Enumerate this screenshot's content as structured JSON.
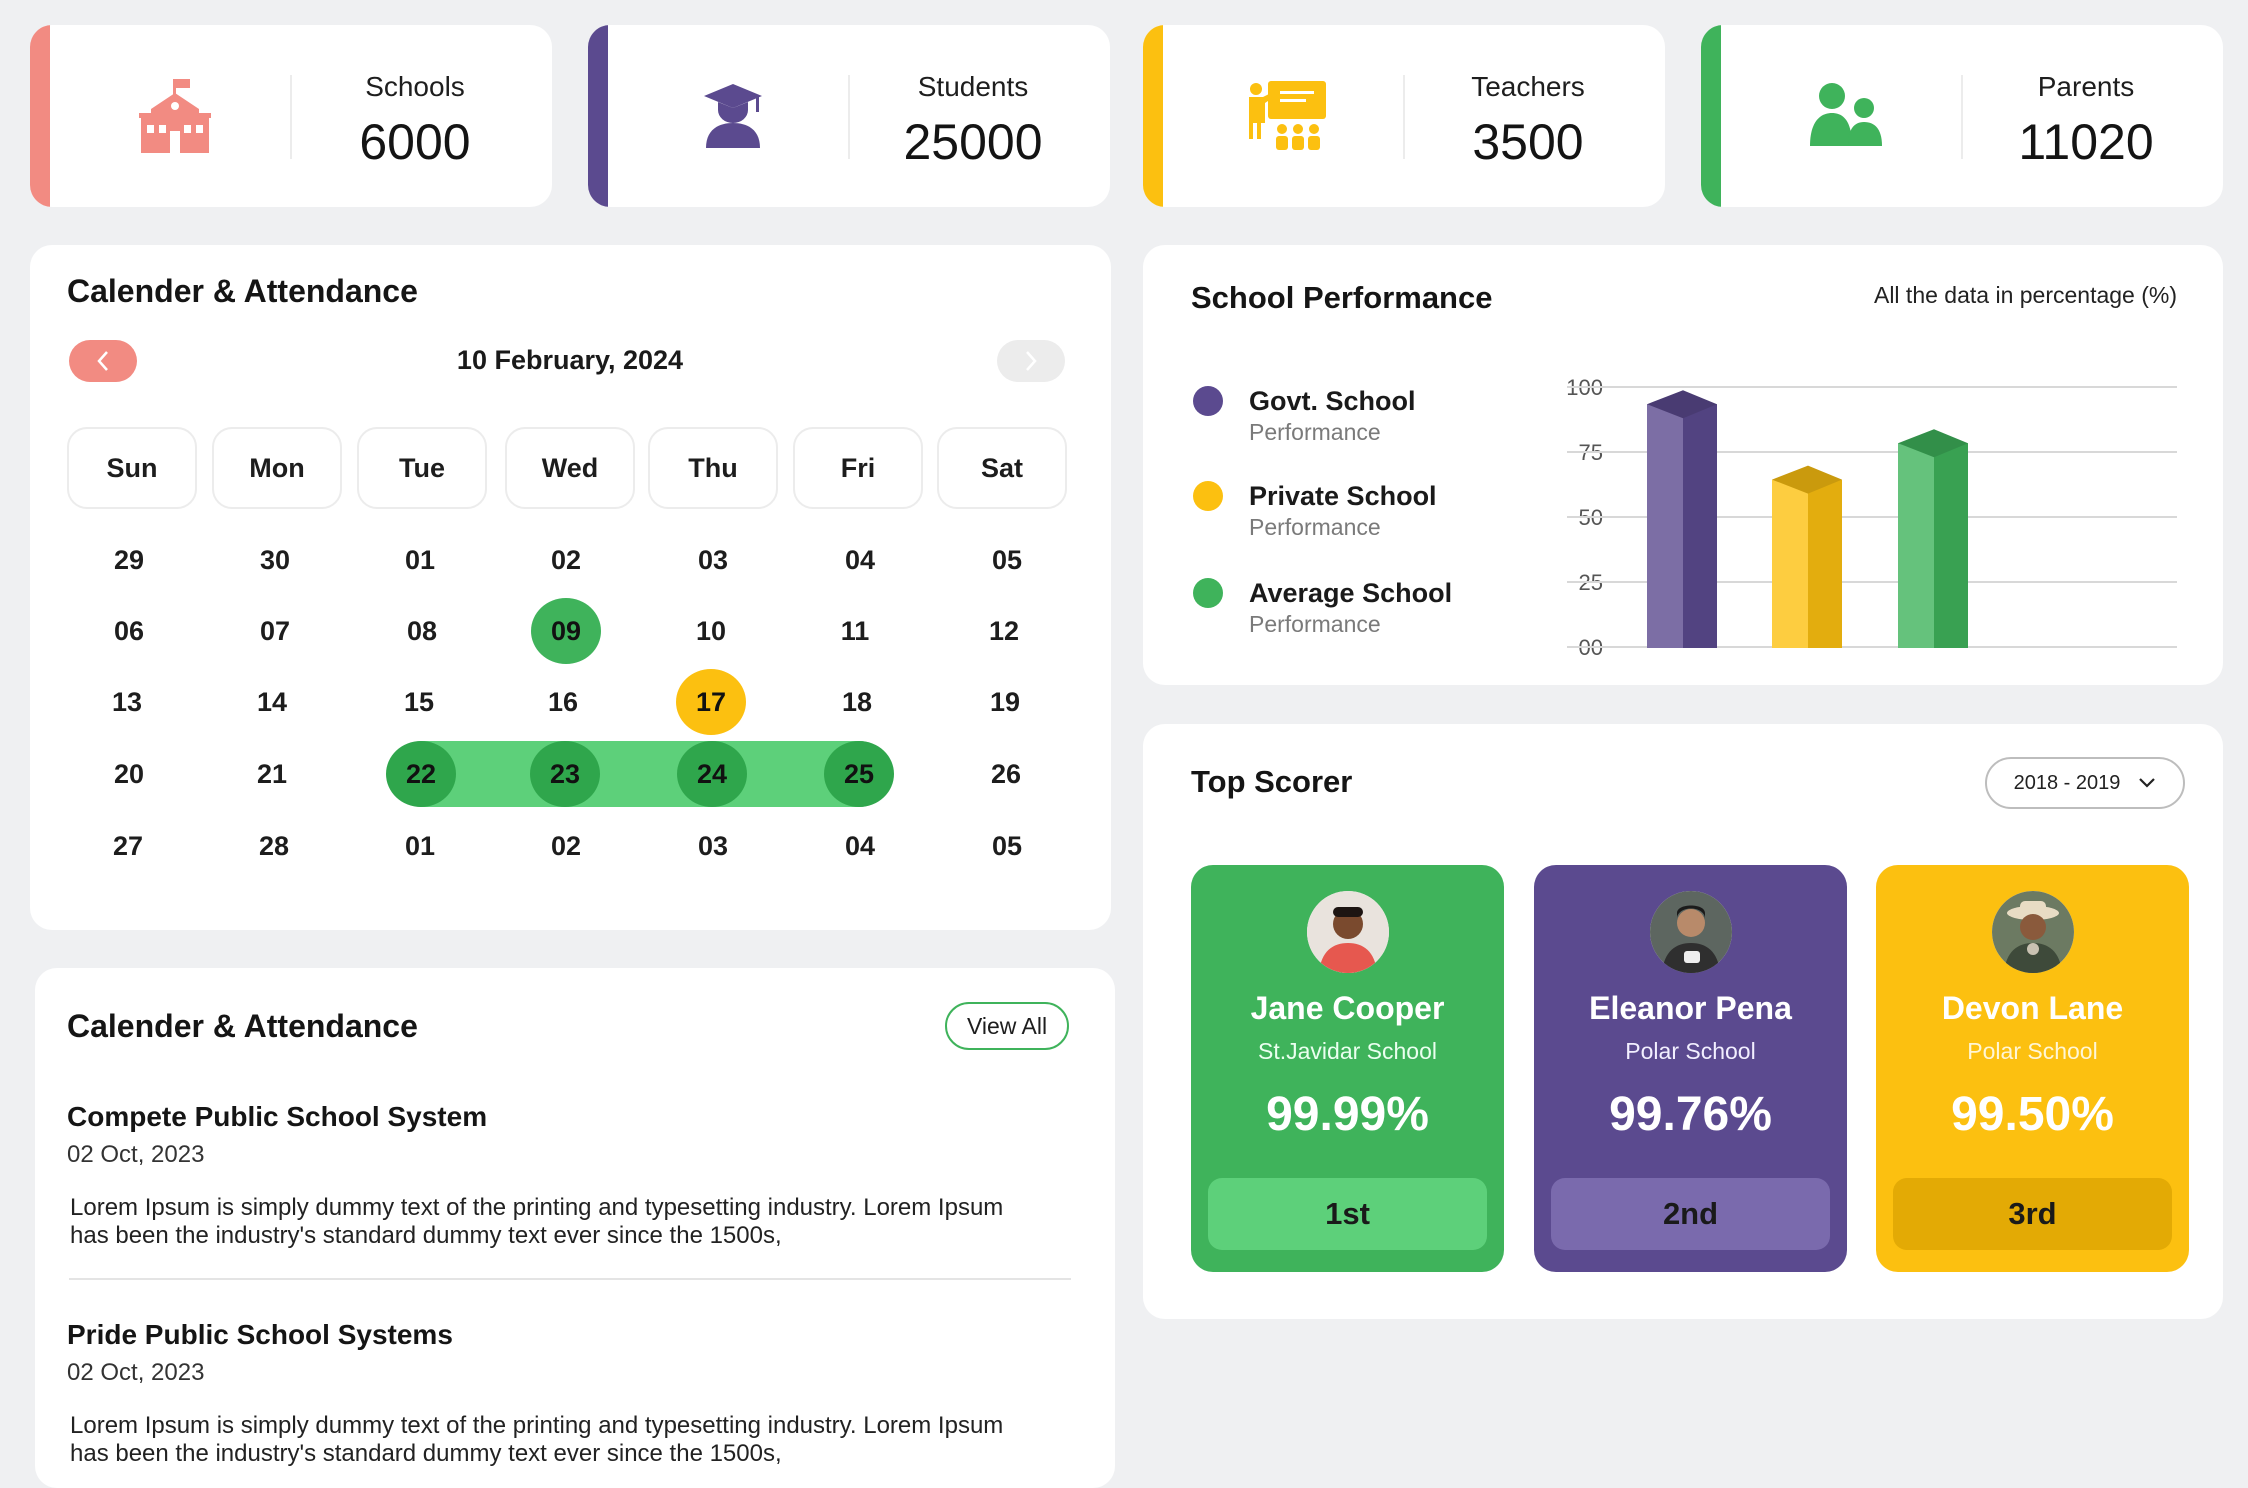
{
  "stats": [
    {
      "label": "Schools",
      "value": "6000",
      "color": "#f28b82",
      "icon": "school-building-icon"
    },
    {
      "label": "Students",
      "value": "25000",
      "color": "#5b4a8f",
      "icon": "graduate-student-icon"
    },
    {
      "label": "Teachers",
      "value": "3500",
      "color": "#fcc010",
      "icon": "teacher-classroom-icon"
    },
    {
      "label": "Parents",
      "value": "11020",
      "color": "#3fb35b",
      "icon": "parents-group-icon"
    }
  ],
  "calendar": {
    "title": "Calender & Attendance",
    "date": "10 February, 2024",
    "prev_icon": "chevron-left-icon",
    "next_icon": "chevron-right-icon",
    "weekdays": [
      "Sun",
      "Mon",
      "Tue",
      "Wed",
      "Thu",
      "Fri",
      "Sat"
    ],
    "weeks": [
      [
        "29",
        "30",
        "01",
        "02",
        "03",
        "04",
        "05"
      ],
      [
        "06",
        "07",
        "08",
        "09",
        "10",
        "11",
        "12"
      ],
      [
        "13",
        "14",
        "15",
        "16",
        "17",
        "18",
        "19"
      ],
      [
        "20",
        "21",
        "22",
        "23",
        "24",
        "25",
        "26"
      ],
      [
        "27",
        "28",
        "01",
        "02",
        "03",
        "04",
        "05"
      ]
    ],
    "highlight_green": "09",
    "highlight_yellow": "17",
    "range": [
      "22",
      "23",
      "24",
      "25"
    ]
  },
  "news": {
    "title": "Calender & Attendance",
    "view_all": "View All",
    "items": [
      {
        "heading": "Compete Public School System",
        "date": "02 Oct, 2023",
        "text": "Lorem Ipsum is simply dummy text of the printing and  typesetting industry. Lorem Ipsum has been the industry's standard dummy  text ever since the 1500s,"
      },
      {
        "heading": "Pride Public School Systems",
        "date": "02 Oct, 2023",
        "text": "Lorem Ipsum is simply dummy text of the printing and  typesetting industry. Lorem Ipsum has been the industry's standard dummy  text ever since the 1500s,"
      }
    ]
  },
  "performance": {
    "title": "School Performance",
    "note": "All the data in percentage (%)",
    "legend": [
      {
        "title": "Govt. School",
        "sub": "Performance",
        "color": "#5b4a8f"
      },
      {
        "title": "Private School",
        "sub": "Performance",
        "color": "#fcc010"
      },
      {
        "title": "Average School",
        "sub": "Performance",
        "color": "#3fb35b"
      }
    ],
    "yticks": [
      "100",
      "75",
      "50",
      "25",
      "00"
    ]
  },
  "chart_data": {
    "type": "bar",
    "title": "School Performance",
    "ylabel": "",
    "ylim": [
      0,
      100
    ],
    "grid": true,
    "legend_position": "left",
    "categories": [
      "Govt. School",
      "Private School",
      "Average School"
    ],
    "values": [
      93,
      64,
      78
    ],
    "colors": [
      "#5b4a8f",
      "#fcc010",
      "#3fb35b"
    ]
  },
  "top_scorer": {
    "title": "Top Scorer",
    "year_select": "2018 - 2019",
    "scorers": [
      {
        "name": "Jane Cooper",
        "school": "St.Javidar School",
        "score": "99.99%",
        "rank": "1st",
        "color": "#3fb35b",
        "rank_color": "#5dd07a",
        "school_color": "#eaffef"
      },
      {
        "name": "Eleanor Pena",
        "school": "Polar School",
        "score": "99.76%",
        "rank": "2nd",
        "color": "#5b4a8f",
        "rank_color": "#7a6aad",
        "school_color": "#f2efff"
      },
      {
        "name": "Devon Lane",
        "school": "Polar School",
        "score": "99.50%",
        "rank": "3rd",
        "color": "#fcc010",
        "rank_color": "#e3aa05",
        "school_color": "#fff6d6"
      }
    ]
  }
}
